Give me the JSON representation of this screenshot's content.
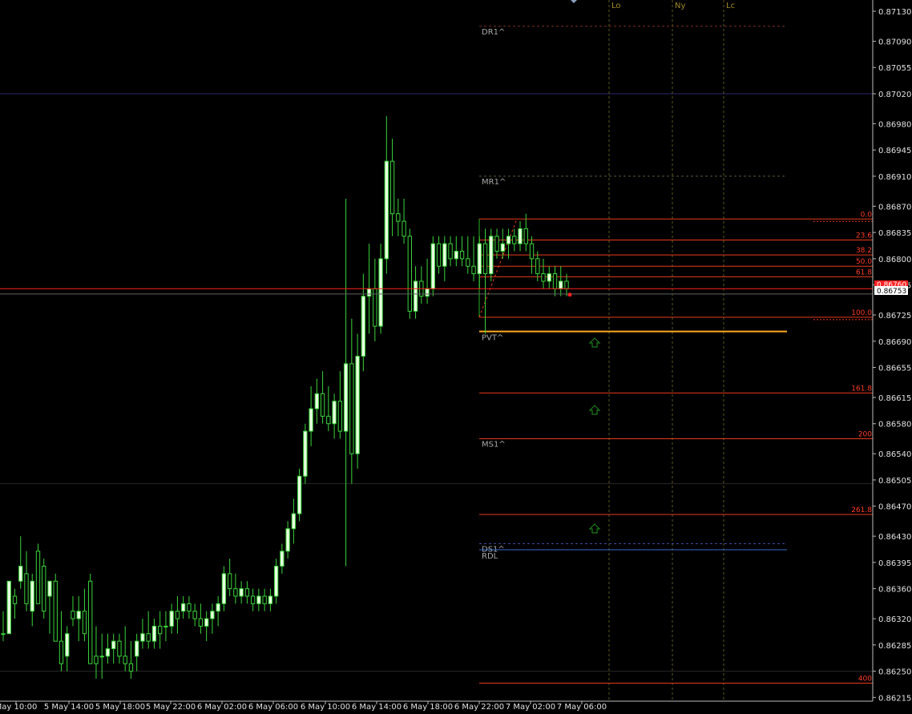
{
  "colors": {
    "background": "#000000",
    "bull_body": "#e8ffe0",
    "bear_body": "#000000",
    "wick": "#3ad43a",
    "fib_line": "#e83a1c",
    "bid_line": "#ff2020",
    "pvt_line": "#ffaa20",
    "session_line": "#5a5a20",
    "pivot_dash": "#7a3020",
    "rdl_line": "#3a6ad0",
    "arrow": "#1e7a1e",
    "axis_text": "#e0e0e0"
  },
  "chart_data": {
    "type": "candlestick",
    "symbol_price_axis": {
      "ylim": [
        0.8621,
        0.87145
      ],
      "ticks": [
        "0.87130",
        "0.87090",
        "0.87055",
        "0.87020",
        "0.86980",
        "0.86945",
        "0.86910",
        "0.86870",
        "0.86835",
        "0.86800",
        "0.86765",
        "0.86725",
        "0.86690",
        "0.86655",
        "0.86615",
        "0.86580",
        "0.86540",
        "0.86505",
        "0.86470",
        "0.86430",
        "0.86395",
        "0.86360",
        "0.86320",
        "0.86285",
        "0.86250",
        "0.86215"
      ]
    },
    "time_axis": {
      "ticks": [
        "5 May 10:00",
        "5 May 14:00",
        "5 May 18:00",
        "5 May 22:00",
        "6 May 02:00",
        "6 May 06:00",
        "6 May 10:00",
        "6 May 14:00",
        "6 May 18:00",
        "6 May 22:00",
        "7 May 02:00",
        "7 May 06:00"
      ],
      "first_label_partial": "May 10:00"
    },
    "current_price_labels": [
      "0.86753",
      "0.86760"
    ],
    "candles": [
      [
        0.863,
        0.8633,
        0.8629,
        0.863
      ],
      [
        0.863,
        0.8637,
        0.863,
        0.8637
      ],
      [
        0.8635,
        0.8636,
        0.8632,
        0.8634
      ],
      [
        0.8637,
        0.8643,
        0.8636,
        0.8639
      ],
      [
        0.8638,
        0.8641,
        0.8633,
        0.8634
      ],
      [
        0.8633,
        0.8638,
        0.8631,
        0.8637
      ],
      [
        0.8641,
        0.8642,
        0.8634,
        0.8634
      ],
      [
        0.8639,
        0.864,
        0.8632,
        0.8633
      ],
      [
        0.8635,
        0.8637,
        0.863,
        0.8637
      ],
      [
        0.8637,
        0.8638,
        0.8629,
        0.8629
      ],
      [
        0.8629,
        0.8633,
        0.8625,
        0.8626
      ],
      [
        0.8627,
        0.8631,
        0.8625,
        0.863
      ],
      [
        0.8633,
        0.8635,
        0.8631,
        0.8632
      ],
      [
        0.8632,
        0.8635,
        0.8629,
        0.8633
      ],
      [
        0.8633,
        0.8636,
        0.8629,
        0.863
      ],
      [
        0.8637,
        0.8638,
        0.8626,
        0.8626
      ],
      [
        0.8627,
        0.8631,
        0.8624,
        0.8626
      ],
      [
        0.8627,
        0.863,
        0.8624,
        0.8627
      ],
      [
        0.8627,
        0.863,
        0.8626,
        0.8628
      ],
      [
        0.8628,
        0.863,
        0.8626,
        0.8629
      ],
      [
        0.8629,
        0.863,
        0.8626,
        0.8627
      ],
      [
        0.8627,
        0.8631,
        0.8625,
        0.8626
      ],
      [
        0.8626,
        0.8629,
        0.8624,
        0.8625
      ],
      [
        0.8627,
        0.863,
        0.8625,
        0.8629
      ],
      [
        0.8629,
        0.8632,
        0.8628,
        0.863
      ],
      [
        0.863,
        0.8633,
        0.8628,
        0.8629
      ],
      [
        0.8629,
        0.8632,
        0.8628,
        0.8631
      ],
      [
        0.8631,
        0.8633,
        0.8628,
        0.863
      ],
      [
        0.8631,
        0.8633,
        0.8629,
        0.8631
      ],
      [
        0.8631,
        0.8634,
        0.863,
        0.8633
      ],
      [
        0.8633,
        0.8635,
        0.863,
        0.8632
      ],
      [
        0.8633,
        0.8635,
        0.8632,
        0.8634
      ],
      [
        0.8634,
        0.8635,
        0.8632,
        0.8633
      ],
      [
        0.8633,
        0.8634,
        0.8631,
        0.8632
      ],
      [
        0.8632,
        0.8634,
        0.863,
        0.8631
      ],
      [
        0.8631,
        0.8633,
        0.8629,
        0.8632
      ],
      [
        0.8632,
        0.8634,
        0.863,
        0.8633
      ],
      [
        0.8633,
        0.8635,
        0.8631,
        0.8634
      ],
      [
        0.8634,
        0.8639,
        0.8633,
        0.8638
      ],
      [
        0.8638,
        0.864,
        0.8635,
        0.8636
      ],
      [
        0.8636,
        0.8638,
        0.8634,
        0.8635
      ],
      [
        0.8635,
        0.8637,
        0.8634,
        0.8636
      ],
      [
        0.8636,
        0.8637,
        0.8634,
        0.8635
      ],
      [
        0.8635,
        0.8636,
        0.8633,
        0.8634
      ],
      [
        0.8634,
        0.8636,
        0.8633,
        0.8635
      ],
      [
        0.8635,
        0.8636,
        0.8633,
        0.8634
      ],
      [
        0.8634,
        0.8636,
        0.8633,
        0.8635
      ],
      [
        0.8635,
        0.864,
        0.8634,
        0.8639
      ],
      [
        0.8639,
        0.8642,
        0.8638,
        0.8641
      ],
      [
        0.8641,
        0.8645,
        0.864,
        0.8644
      ],
      [
        0.8644,
        0.8648,
        0.8642,
        0.8646
      ],
      [
        0.8646,
        0.8652,
        0.8645,
        0.8651
      ],
      [
        0.8651,
        0.8658,
        0.865,
        0.8657
      ],
      [
        0.8657,
        0.8663,
        0.8655,
        0.866
      ],
      [
        0.866,
        0.8664,
        0.8658,
        0.8662
      ],
      [
        0.8662,
        0.8665,
        0.8658,
        0.8659
      ],
      [
        0.8659,
        0.8663,
        0.8657,
        0.8658
      ],
      [
        0.8658,
        0.8662,
        0.8656,
        0.8661
      ],
      [
        0.8661,
        0.8665,
        0.8656,
        0.8657
      ],
      [
        0.8657,
        0.8688,
        0.8639,
        0.8666
      ],
      [
        0.8666,
        0.8672,
        0.865,
        0.8654
      ],
      [
        0.8654,
        0.867,
        0.8652,
        0.8667
      ],
      [
        0.8667,
        0.8678,
        0.8665,
        0.8675
      ],
      [
        0.8675,
        0.8682,
        0.867,
        0.8676
      ],
      [
        0.8676,
        0.868,
        0.8669,
        0.8671
      ],
      [
        0.8671,
        0.8682,
        0.867,
        0.868
      ],
      [
        0.868,
        0.8699,
        0.8678,
        0.8693
      ],
      [
        0.8693,
        0.8696,
        0.8683,
        0.8686
      ],
      [
        0.8686,
        0.8688,
        0.8683,
        0.8685
      ],
      [
        0.8685,
        0.8688,
        0.8682,
        0.8683
      ],
      [
        0.8683,
        0.8684,
        0.8672,
        0.8673
      ],
      [
        0.8673,
        0.8679,
        0.8672,
        0.8677
      ],
      [
        0.8677,
        0.8679,
        0.8674,
        0.8675
      ],
      [
        0.8675,
        0.868,
        0.8674,
        0.8676
      ],
      [
        0.8676,
        0.8683,
        0.8675,
        0.8682
      ],
      [
        0.8682,
        0.8683,
        0.8678,
        0.8679
      ],
      [
        0.8679,
        0.8683,
        0.8677,
        0.8682
      ],
      [
        0.8682,
        0.8683,
        0.8679,
        0.868
      ],
      [
        0.868,
        0.8683,
        0.8679,
        0.8681
      ],
      [
        0.8681,
        0.8683,
        0.8679,
        0.868
      ],
      [
        0.868,
        0.8683,
        0.8678,
        0.8679
      ],
      [
        0.8679,
        0.8683,
        0.8677,
        0.8678
      ],
      [
        0.8678,
        0.8683,
        0.8676,
        0.8682
      ],
      [
        0.8682,
        0.8684,
        0.867,
        0.8678
      ],
      [
        0.8678,
        0.8684,
        0.8677,
        0.8683
      ],
      [
        0.8683,
        0.8684,
        0.868,
        0.8681
      ],
      [
        0.8681,
        0.8684,
        0.868,
        0.8682
      ],
      [
        0.8682,
        0.8684,
        0.868,
        0.8683
      ],
      [
        0.8683,
        0.8684,
        0.8681,
        0.8682
      ],
      [
        0.8682,
        0.8685,
        0.8681,
        0.8684
      ],
      [
        0.8684,
        0.8686,
        0.8681,
        0.8682
      ],
      [
        0.8682,
        0.8683,
        0.8678,
        0.868
      ],
      [
        0.868,
        0.8681,
        0.8677,
        0.8678
      ],
      [
        0.8678,
        0.868,
        0.8676,
        0.8677
      ],
      [
        0.8677,
        0.8679,
        0.8676,
        0.8678
      ],
      [
        0.8678,
        0.8679,
        0.8675,
        0.8676
      ],
      [
        0.8676,
        0.8679,
        0.8675,
        0.8677
      ],
      [
        0.8677,
        0.8678,
        0.8675,
        0.8676
      ]
    ],
    "fib_levels": [
      {
        "label": "0.0",
        "price": 0.86853
      },
      {
        "label": "23.6",
        "price": 0.86825
      },
      {
        "label": "38.2",
        "price": 0.86805
      },
      {
        "label": "50.0",
        "price": 0.8679
      },
      {
        "label": "61.8",
        "price": 0.86776
      },
      {
        "label": "100.0",
        "price": 0.86722
      },
      {
        "label": "161.8",
        "price": 0.86621
      },
      {
        "label": "200",
        "price": 0.8656
      },
      {
        "label": "261.8",
        "price": 0.86459
      },
      {
        "label": "400",
        "price": 0.86234
      }
    ],
    "pivots": [
      {
        "label": "DR1^",
        "price": 0.8711
      },
      {
        "label": "MR1^",
        "price": 0.8691
      },
      {
        "label": "PVT^",
        "price": 0.86703
      },
      {
        "label": "MS1^",
        "price": 0.8656
      },
      {
        "label": "DS1^",
        "price": 0.8642
      },
      {
        "label": "RDL",
        "price": 0.86412
      }
    ],
    "sessions": [
      "Lo",
      "Ny",
      "Lc"
    ],
    "horizontal_lines": [
      0.8702,
      0.865,
      0.8625
    ],
    "bid_price": 0.8676,
    "ask_price": 0.86753
  }
}
